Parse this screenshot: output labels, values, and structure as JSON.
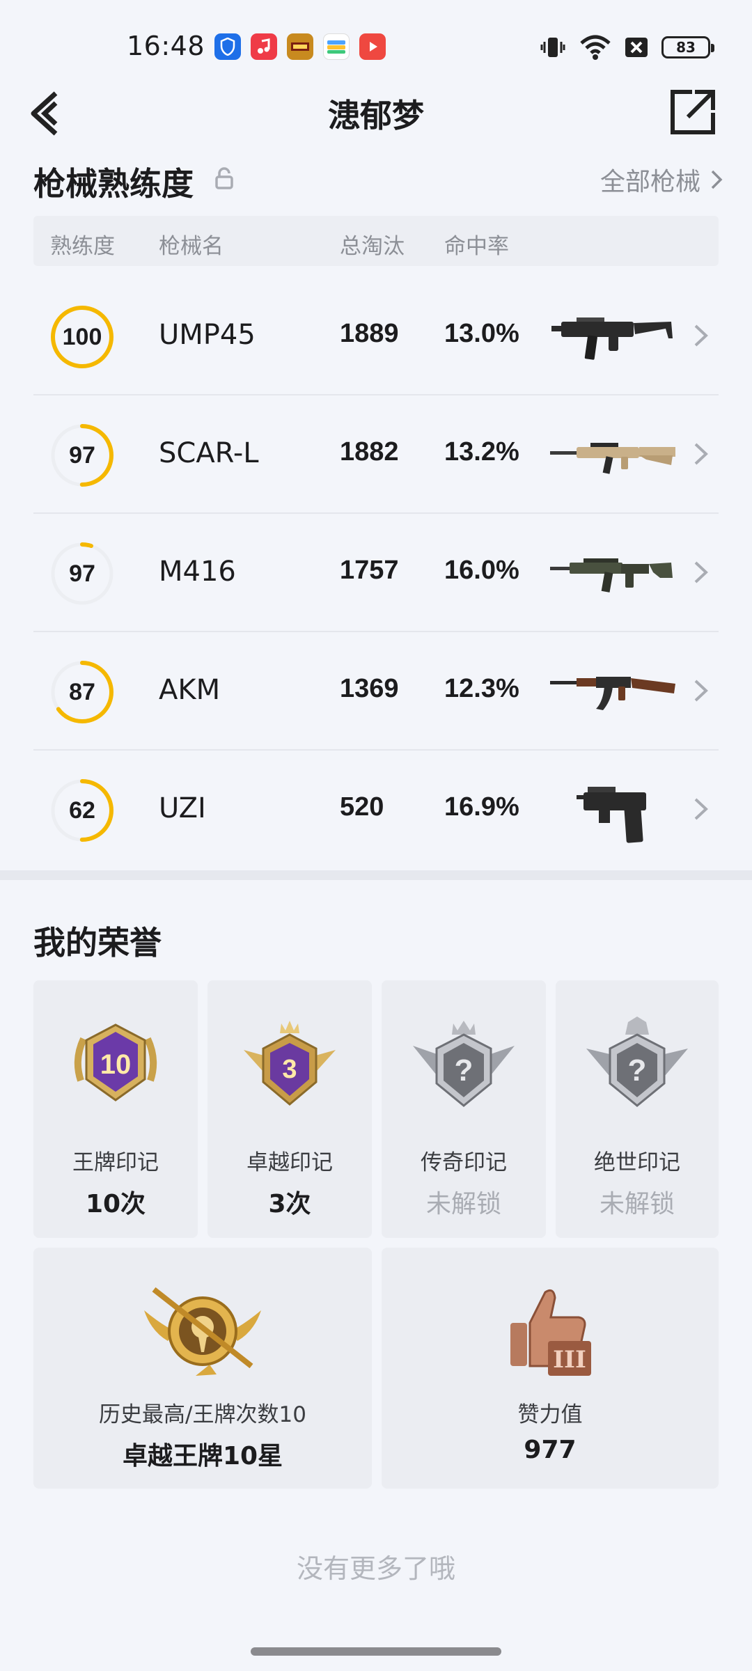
{
  "status_bar": {
    "time": "16:48",
    "battery": "83"
  },
  "header": {
    "title": "漶郁梦"
  },
  "proficiency": {
    "title": "枪械熟练度",
    "all_link": "全部枪械",
    "columns": [
      "熟练度",
      "枪械名",
      "总淘汰",
      "命中率"
    ],
    "rows": [
      {
        "level": "100",
        "progress": 1.0,
        "name": "UMP45",
        "kills": "1889",
        "hit_rate": "13.0%",
        "gun_icon": "ump45-icon"
      },
      {
        "level": "97",
        "progress": 0.5,
        "name": "SCAR-L",
        "kills": "1882",
        "hit_rate": "13.2%",
        "gun_icon": "scar-l-icon"
      },
      {
        "level": "97",
        "progress": 0.05,
        "name": "M416",
        "kills": "1757",
        "hit_rate": "16.0%",
        "gun_icon": "m416-icon"
      },
      {
        "level": "87",
        "progress": 0.65,
        "name": "AKM",
        "kills": "1369",
        "hit_rate": "12.3%",
        "gun_icon": "akm-icon"
      },
      {
        "level": "62",
        "progress": 0.5,
        "name": "UZI",
        "kills": "520",
        "hit_rate": "16.9%",
        "gun_icon": "uzi-icon"
      }
    ]
  },
  "honors": {
    "title": "我的荣誉",
    "cards": [
      {
        "label": "王牌印记",
        "value": "10次",
        "badge_text": "10",
        "locked": false
      },
      {
        "label": "卓越印记",
        "value": "3次",
        "badge_text": "3",
        "locked": false
      },
      {
        "label": "传奇印记",
        "value": "未解锁",
        "badge_text": "?",
        "locked": true
      },
      {
        "label": "绝世印记",
        "value": "未解锁",
        "badge_text": "?",
        "locked": true
      }
    ],
    "wide_cards": [
      {
        "label": "历史最高/王牌次数10",
        "value": "卓越王牌10星"
      },
      {
        "label": "赞力值",
        "value": "977",
        "badge_text": "III"
      }
    ]
  },
  "footer": {
    "text": "没有更多了哦"
  },
  "colors": {
    "accent": "#f5b800",
    "ring_track": "#eceef2",
    "muted": "#8c8f96"
  }
}
